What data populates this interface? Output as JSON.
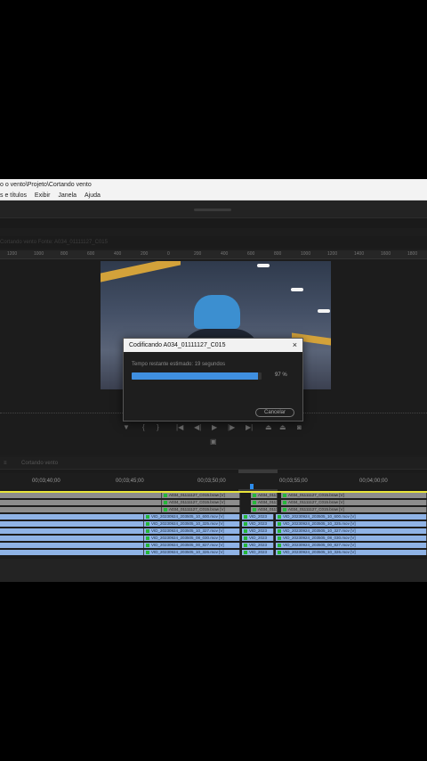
{
  "window": {
    "title": "o o vento\\Projeto\\Cortando vento"
  },
  "menu": [
    "s e títulos",
    "Exibir",
    "Janela",
    "Ajuda"
  ],
  "monitor": {
    "tabs_text": "Cortando vento   Fonte: A034_01111127_C015   ",
    "ruler_ticks": [
      "1200",
      "1000",
      "800",
      "600",
      "400",
      "200",
      "0",
      "200",
      "400",
      "600",
      "800",
      "1000",
      "1200",
      "1400",
      "1600",
      "1800"
    ]
  },
  "dialog": {
    "title": "Codificando A034_01111127_C015",
    "close": "×",
    "message": "Tempo restante estimado: 19 segundos",
    "progress": 0.97,
    "percent": "97 %",
    "cancel": "Cancelar"
  },
  "timeline": {
    "tab": "Cortando vento",
    "timecodes": [
      "00;03;40;00",
      "00;03;45;00",
      "00;03;50;00",
      "00;03;55;00",
      "00;04;00;00"
    ],
    "rows": [
      [
        "A034_01111127_C015.braw [V]",
        "A034_01111127_C015.braw [V]",
        "A034_01111127_C015.braw [V]"
      ],
      [
        "A034_01111127_C015.braw [V]",
        "A034_01111127_C015.braw [V]",
        "A034_01111127_C015.braw [V]"
      ],
      [
        "A034_01111127_C015.braw [V]",
        "A034_01111127_C015.braw [V]",
        "A034_01111127_C015.braw [V]"
      ],
      [
        "VID_20230924_203505_10_600.mov [V]",
        "VID_2023",
        "VID_20230924_203505_10_600.mov [V]"
      ],
      [
        "VID_20230924_203505_10_325.mov [V]",
        "VID_2023",
        "VID_20230924_203505_10_325.mov [V]"
      ],
      [
        "VID_20230924_203505_10_327.mov [V]",
        "VID_2023",
        "VID_20230924_203505_10_327.mov [V]"
      ],
      [
        "VID_20230924_203505_08_030.mov [V]",
        "VID_2023",
        "VID_20230924_203505_08_030.mov [V]"
      ],
      [
        "VID_20230924_203505_00_827.mov [V]",
        "VID_2023",
        "VID_20230924_203505_00_827.mov [V]"
      ],
      [
        "VID_20230924_203505_10_326.mov [V]",
        "VID_2023",
        "VID_20230924_203505_10_326.mov [V]"
      ]
    ]
  }
}
